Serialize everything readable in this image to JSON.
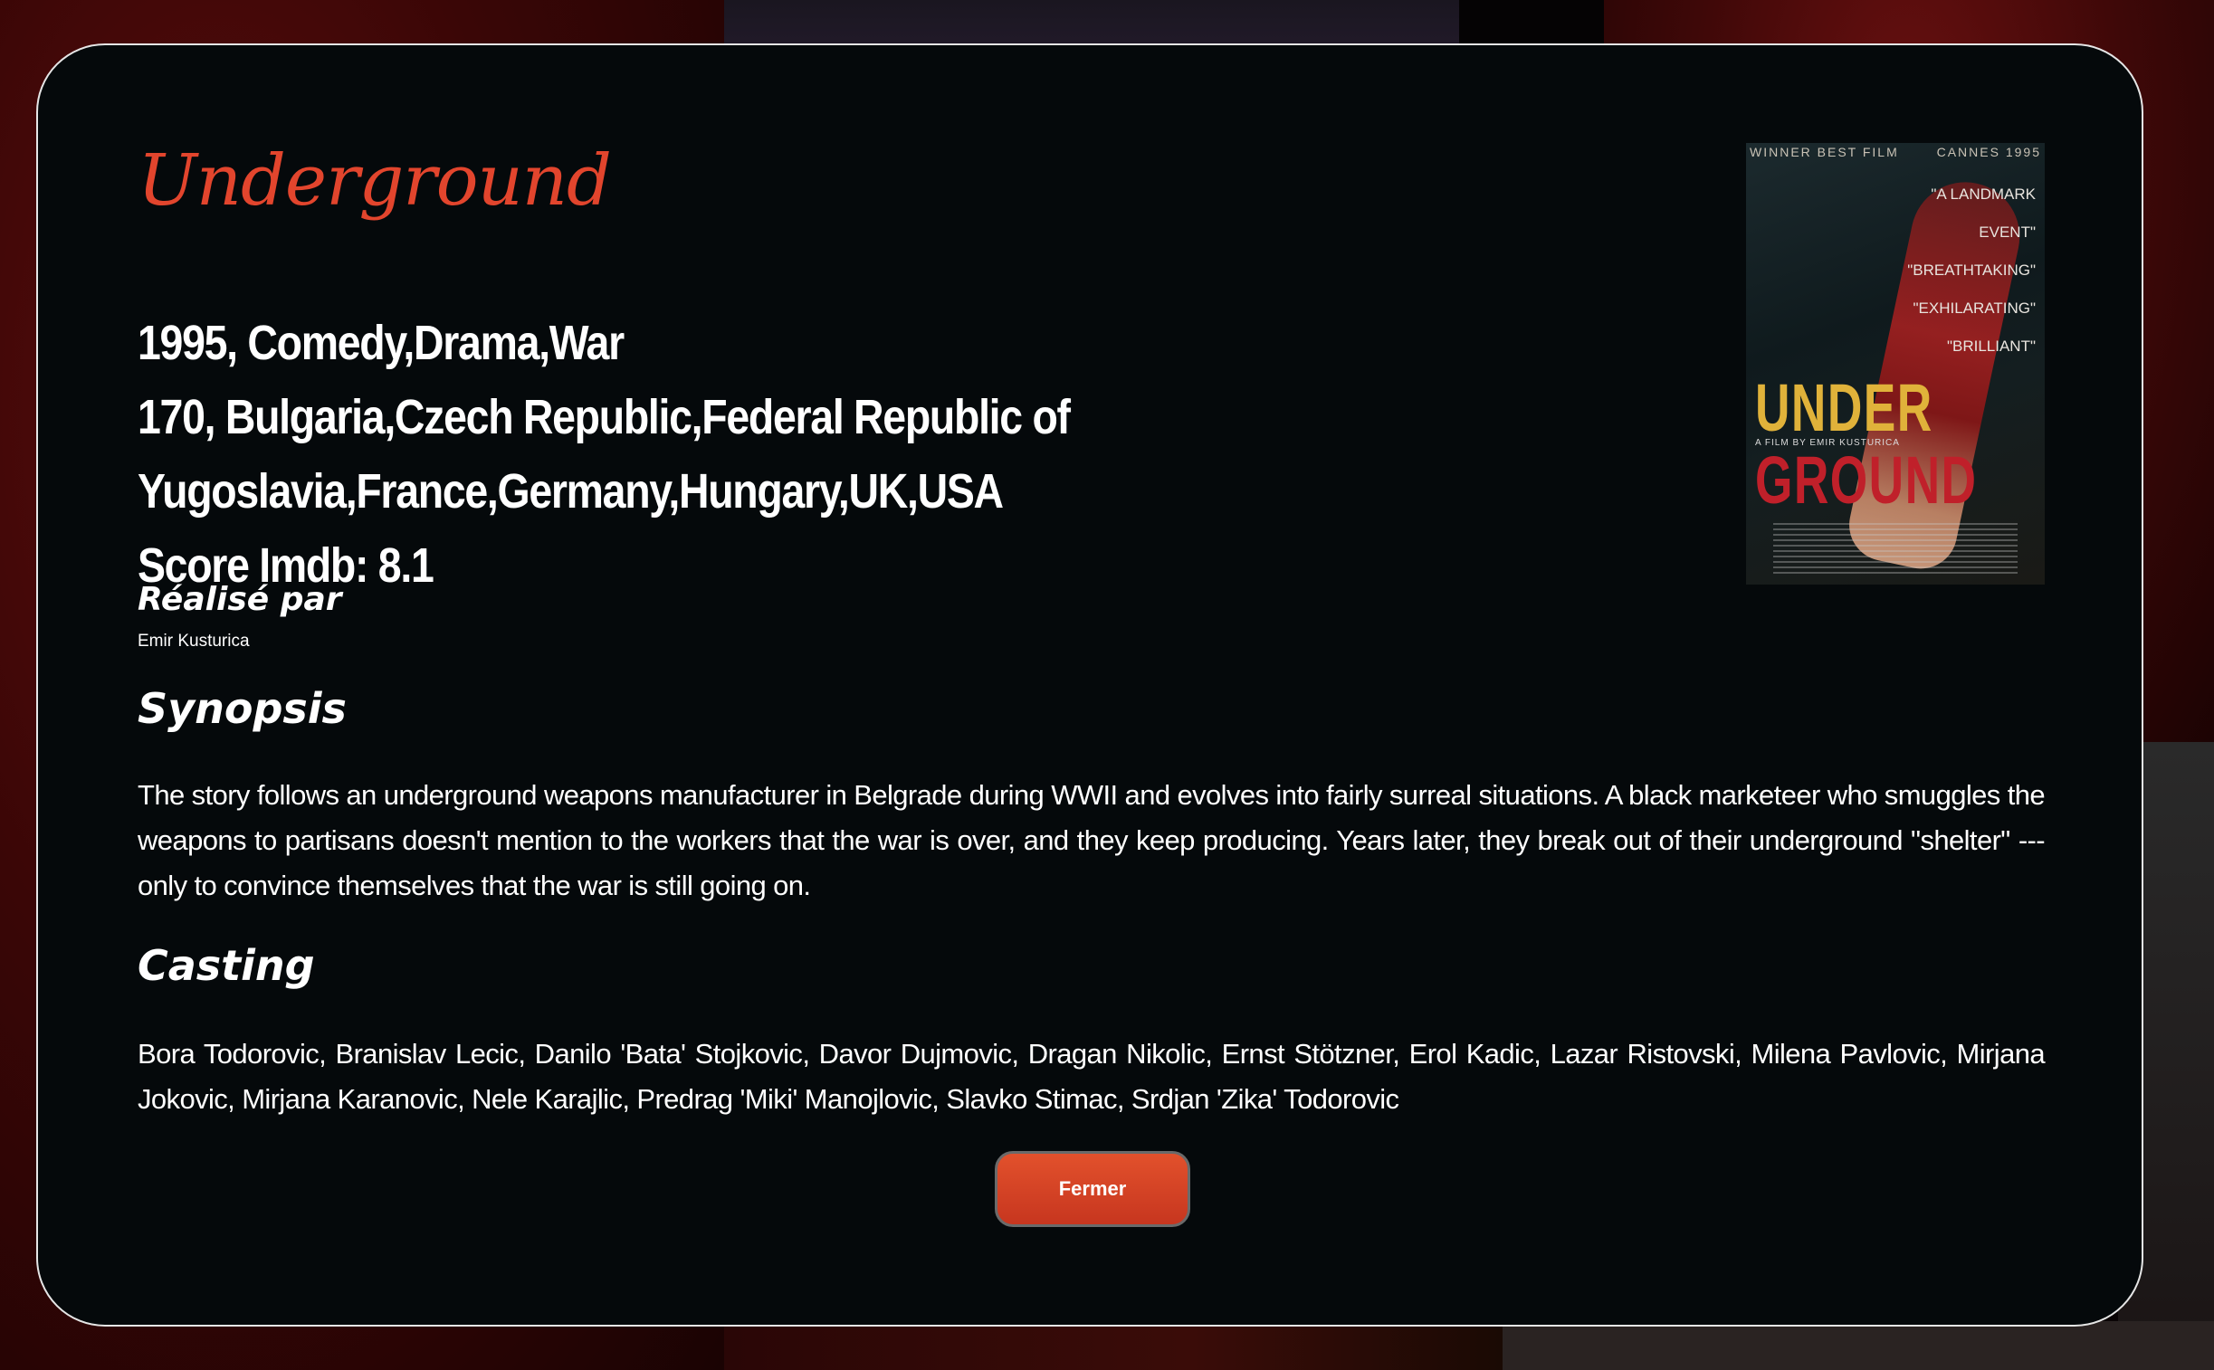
{
  "movie": {
    "title": "Underground",
    "year_genres": "1995, Comedy,Drama,War",
    "duration_countries_line1": "170, Bulgaria,Czech Republic,Federal Republic of",
    "duration_countries_line2": "Yugoslavia,France,Germany,Hungary,UK,USA",
    "score": "Score Imdb: 8.1",
    "director_heading": "Réalisé par",
    "director": "Emir Kusturica",
    "synopsis_heading": "Synopsis",
    "synopsis": "The story follows an underground weapons manufacturer in Belgrade during WWII and evolves into fairly surreal situations. A black marketeer who smuggles the weapons to partisans doesn't mention to the workers that the war is over, and they keep producing. Years later, they break out of their underground \"shelter\" --- only to convince themselves that the war is still going on.",
    "casting_heading": "Casting",
    "casting": "Bora Todorovic, Branislav Lecic, Danilo 'Bata' Stojkovic, Davor Dujmovic, Dragan Nikolic, Ernst Stötzner, Erol Kadic, Lazar Ristovski, Milena Pavlovic, Mirjana Jokovic, Mirjana Karanovic, Nele Karajlic, Predrag 'Miki' Manojlovic, Slavko Stimac, Srdjan 'Zika' Todorovic"
  },
  "poster": {
    "top_left": "WINNER BEST FILM",
    "top_right": "CANNES 1995",
    "quotes": [
      "\"A LANDMARK EVENT\"",
      "\"BREATHTAKING\"",
      "\"EXHILARATING\"",
      "\"BRILLIANT\""
    ],
    "word1": "UNDER",
    "word2": "GROUND",
    "credit": "A FILM BY EMIR KUSTURICA"
  },
  "actions": {
    "close_label": "Fermer"
  },
  "colors": {
    "title": "#e2452d",
    "button": "#d8432a",
    "modal_bg": "#05090b"
  }
}
